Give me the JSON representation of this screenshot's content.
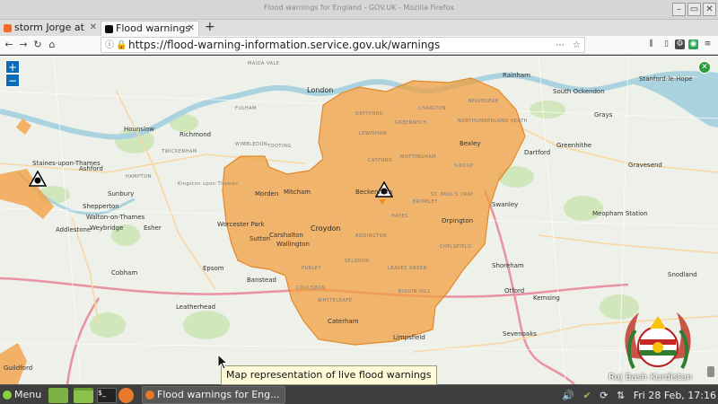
{
  "window": {
    "title": "Flood warnings for England - GOV.UK - Mozilla Firefox",
    "controls": [
      "–",
      "▭",
      "✕"
    ]
  },
  "tabs": [
    {
      "label": "storm Jorge at",
      "close": "✕",
      "active": false
    },
    {
      "label": "Flood warnings",
      "close": "✕",
      "active": true
    }
  ],
  "new_tab": "+",
  "nav": {
    "back": "←",
    "forward": "→",
    "reload": "↻",
    "home": "⌂",
    "url": "https://flood-warning-information.service.gov.uk/warnings"
  },
  "map": {
    "zoom_in": "+",
    "zoom_out": "−",
    "labels": {
      "london": "London",
      "croydon": "Croydon",
      "sutton": "Sutton",
      "morden": "Morden",
      "mitcham": "Mitcham",
      "beckenham": "Beckenham",
      "bexley": "Bexley",
      "orpington": "Orpington",
      "carshalton": "Carshalton",
      "wallington": "Wallington",
      "worcester_park": "Worcester Park",
      "caterham": "Caterham",
      "limpsfield": "Limpsfield",
      "dartford": "Dartford",
      "swanley": "Swanley",
      "greenhithe": "Greenhithe",
      "gravesend": "Gravesend",
      "meopham": "Meopham Station",
      "epsom": "Epsom",
      "banstead": "Banstead",
      "leatherhead": "Leatherhead",
      "cobham": "Cobham",
      "weybridge": "Weybridge",
      "walton": "Walton-on-Thames",
      "shepperton": "Shepperton",
      "addlestone": "Addlestone",
      "sunbury": "Sunbury",
      "ashford": "Ashford",
      "staines": "Staines-upon-Thames",
      "hounslow": "Hounslow",
      "richmond": "Richmond",
      "kingston": "Kingston upon Thames",
      "esher": "Esher",
      "rainham": "Rainham",
      "south_ockendon": "South Ockendon",
      "stanford": "Stanford-le-Hope",
      "grays": "Grays",
      "shoreham": "Shoreham",
      "otford": "Otford",
      "kemsing": "Kemsing",
      "sevenoaks": "Sevenoaks",
      "snodland": "Snodland",
      "guildford": "Guildford",
      "lewisham": "LEWISHAM",
      "greenwich": "GREENWICH",
      "bromley": "BROMLEY",
      "sidcup": "SIDCUP",
      "catford": "CATFORD",
      "deptford": "DEPTFORD",
      "mottingham": "MOTTINGHAM",
      "hayes": "HAYES",
      "addington": "ADDINGTON",
      "purley": "PURLEY",
      "coulsdon": "COULSDON",
      "whyteleafe": "WHYTELEAFE",
      "biggin_hill": "BIGGIN HILL",
      "leaves_green": "LEAVES GREEN",
      "chelsfield": "CHELSFIELD",
      "st_pauls_cray": "ST. PAUL'S CRAY",
      "belvedere": "BELVEDERE",
      "charlton": "CHARLTON",
      "thamesmead": "NORTHUMBERLAND HEATH",
      "twickenham": "TWICKENHAM",
      "hampton": "HAMPTON",
      "maida_vale": "MAIDA VALE",
      "fulham": "FULHAM",
      "tooting": "TOOTING",
      "wimbledon": "WIMBLEDON",
      "selsdon": "SELSDON"
    }
  },
  "tooltip": "Map representation of live flood warnings",
  "emblem_text": "Roj Bash Kurdistan",
  "taskbar": {
    "menu": "Menu",
    "task": "Flood warnings for Eng...",
    "clock": "Fri 28 Feb, 17:16"
  },
  "colors": {
    "warning_area": "#f39c3b",
    "river": "#aad3df",
    "map_bg": "#eef0ea",
    "link_blue": "#0b6bb8"
  }
}
